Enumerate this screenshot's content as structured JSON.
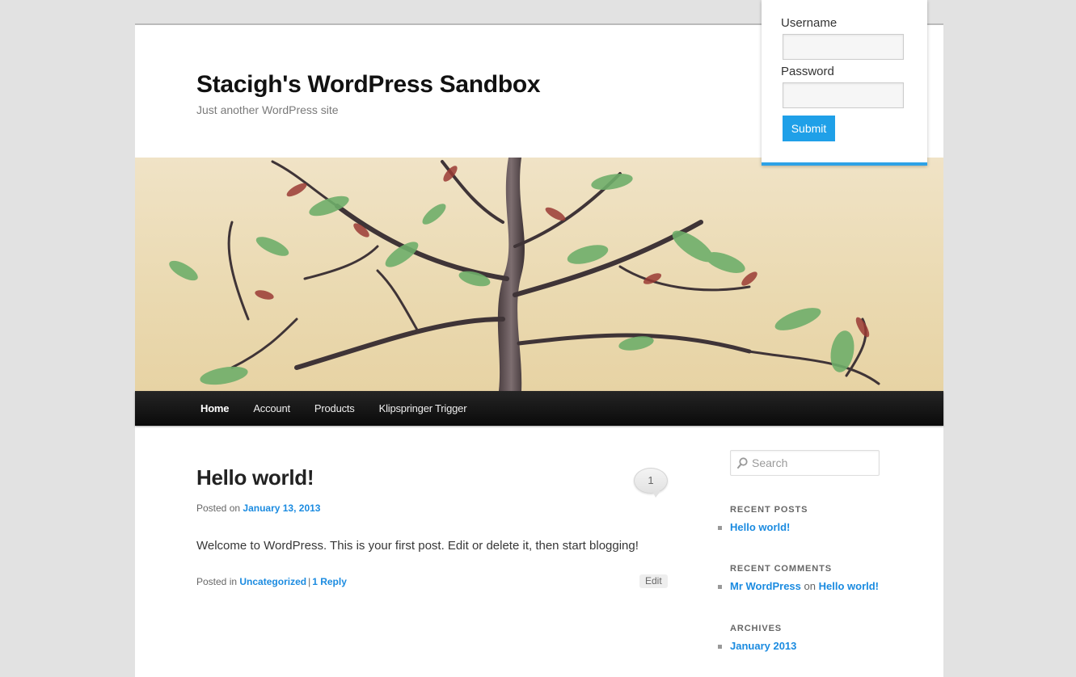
{
  "site": {
    "title": "Stacigh's WordPress Sandbox",
    "description": "Just another WordPress site"
  },
  "banner": {
    "alt": "bonsai-tree-header-image"
  },
  "nav": {
    "items": [
      {
        "label": "Home",
        "current": true
      },
      {
        "label": "Account",
        "current": false
      },
      {
        "label": "Products",
        "current": false
      },
      {
        "label": "Klipspringer Trigger",
        "current": false
      }
    ]
  },
  "post": {
    "title": "Hello world!",
    "comment_count": "1",
    "posted_on_label": "Posted on",
    "date": "January 13, 2013",
    "content": "Welcome to WordPress. This is your first post. Edit or delete it, then start blogging!",
    "posted_in_label": "Posted in",
    "category": "Uncategorized",
    "separator": "|",
    "reply_link": "1 Reply",
    "edit_label": "Edit"
  },
  "sidebar": {
    "search_placeholder": "Search",
    "recent_posts": {
      "title": "RECENT POSTS",
      "items": [
        "Hello world!"
      ]
    },
    "recent_comments": {
      "title": "RECENT COMMENTS",
      "author": "Mr WordPress",
      "on_label": "on",
      "post": "Hello world!"
    },
    "archives": {
      "title": "ARCHIVES",
      "items": [
        "January 2013"
      ]
    }
  },
  "login": {
    "username_label": "Username",
    "password_label": "Password",
    "submit_label": "Submit"
  },
  "colors": {
    "link": "#1b8be0",
    "accent": "#2ea2e6",
    "nav_bg": "#111111"
  }
}
